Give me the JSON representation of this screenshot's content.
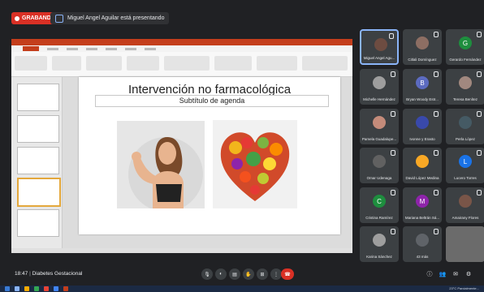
{
  "recording": {
    "label": "GRABANDO"
  },
  "presenting": {
    "label": "Miguel Angel Aguilar está presentando"
  },
  "slide": {
    "title": "Intervención no farmacológica",
    "subtitle": "Subtítulo de agenda"
  },
  "participants": [
    {
      "name": "Miguel Angel Agu...",
      "initial": "",
      "color": "#6d4c41",
      "photo": true
    },
    {
      "name": "Citlali Domínguez",
      "initial": "",
      "color": "#8d6e63",
      "photo": true
    },
    {
      "name": "Gerardo Fernández",
      "initial": "G",
      "color": "#1e8e3e",
      "photo": false
    },
    {
      "name": "Michelle Hernández",
      "initial": "",
      "color": "#9e9e9e",
      "photo": true
    },
    {
      "name": "Bryan Woody Estr...",
      "initial": "B",
      "color": "#5c6bc0",
      "photo": false
    },
    {
      "name": "Teresa Benítez",
      "initial": "",
      "color": "#a1887f",
      "photo": true
    },
    {
      "name": "Pamela Guadalupe...",
      "initial": "",
      "color": "#c48b7a",
      "photo": true
    },
    {
      "name": "Ivonne y Erasto",
      "initial": "",
      "color": "#3949ab",
      "photo": true
    },
    {
      "name": "Perla López",
      "initial": "",
      "color": "#455a64",
      "photo": true
    },
    {
      "name": "Omar Udenaga",
      "initial": "",
      "color": "#616161",
      "photo": true
    },
    {
      "name": "David López Medina",
      "initial": "",
      "color": "#f9a825",
      "photo": true
    },
    {
      "name": "Lucero Torres",
      "initial": "L",
      "color": "#1a73e8",
      "photo": false
    },
    {
      "name": "Cristina Ramírez",
      "initial": "C",
      "color": "#1e8e3e",
      "photo": false
    },
    {
      "name": "Mariana Beltrán Sá...",
      "initial": "M",
      "color": "#8e24aa",
      "photo": false
    },
    {
      "name": "Amairany Flores",
      "initial": "",
      "color": "#795548",
      "photo": true
    },
    {
      "name": "Karina Sánchez",
      "initial": "",
      "color": "#9e9e9e",
      "photo": true
    },
    {
      "name": "43 más",
      "initial": "",
      "color": "#5f6368",
      "photo": true
    }
  ],
  "meeting": {
    "time": "18:47",
    "title": "Diabetes Gestacional"
  },
  "taskbar": {
    "status": "23°C Parcialmente..."
  }
}
